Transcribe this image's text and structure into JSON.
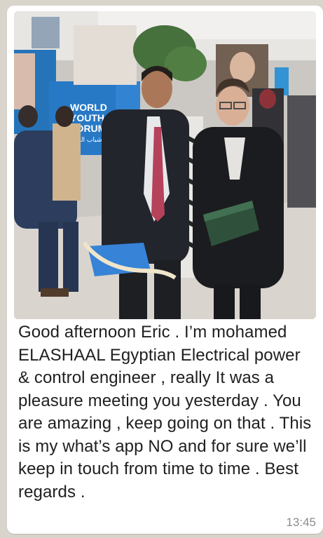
{
  "message": {
    "text": "Good afternoon Eric . I’m mohamed ELASHAAL Egyptian Electrical  power & control engineer , really It was a pleasure meeting you yesterday . You are amazing , keep going on that . This is my what’s app NO and for sure we’ll keep in touch from time to time . Best regards .",
    "time": "13:45"
  },
  "photo": {
    "booth_sign": {
      "line1": "WORLD",
      "line2": "YOUTH",
      "line3": "FORUM",
      "line4": "منتدى شباب العالم"
    }
  },
  "colors": {
    "bubble": "#ffffff",
    "background": "#d9d4cc",
    "text": "#1f1f1f",
    "timestamp": "#8c8c8c"
  }
}
